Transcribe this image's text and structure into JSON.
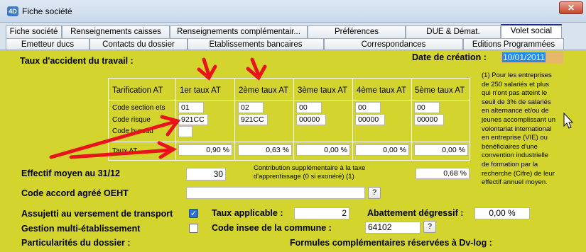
{
  "window": {
    "title": "Fiche société",
    "app_icon": "4D",
    "close_label": "✕"
  },
  "tabs_row1": [
    {
      "label": "Fiche société"
    },
    {
      "label": "Renseignements caisses"
    },
    {
      "label": "Renseignements complémentair..."
    },
    {
      "label": "Préférences"
    },
    {
      "label": "DUE & Démat."
    },
    {
      "label": "Volet social",
      "active": true
    }
  ],
  "tabs_row2": [
    {
      "label": "Emetteur ducs"
    },
    {
      "label": "Contacts du dossier"
    },
    {
      "label": "Etablissements bancaires"
    },
    {
      "label": "Correspondances"
    },
    {
      "label": "Editions Programmées"
    }
  ],
  "section": {
    "title": "Taux d'accident du travail :",
    "date_label": "Date de création :",
    "date_value": "10/01/2011"
  },
  "at_table": {
    "header_label": "Tarification AT",
    "columns": [
      "1er taux AT",
      "2ème taux AT",
      "3ème taux AT",
      "4ème taux AT",
      "5ème taux AT"
    ],
    "row_labels": [
      "Code section ets",
      "Code risque",
      "Code bureau",
      "Taux AT"
    ],
    "code_section": [
      "01",
      "02",
      "00",
      "00",
      "00"
    ],
    "code_risque": [
      "921CC",
      "921CC",
      "00000",
      "00000",
      "00000"
    ],
    "taux": [
      "0,90 %",
      "0,63 %",
      "0,00 %",
      "0,00 %",
      "0,00 %"
    ]
  },
  "note": "(1) Pour les entreprises\nde 250 salariés et plus\nqui n'ont pas atteint le\nseuil de 3% de salariés\nen alternance et/ou de\njeunes accomplissant un\nvolontariat international\nen entreprise (VIE) ou\nbénéficiaires d'une\nconvention industrielle\nde formation par la\nrecherche (Cifre) de leur\neffectif annuel moyen.",
  "effectif": {
    "label": "Effectif moyen au 31/12",
    "value": "30"
  },
  "contribution": {
    "label_line1": "Contribution supplémentaire à la taxe",
    "label_line2": "d'apprentissage (0 si exonéré) (1)",
    "value": "0,68 %"
  },
  "oeht": {
    "label": "Code accord agréé OEHT",
    "value": "",
    "help": "?"
  },
  "transport": {
    "label": "Assujetti au versement de transport",
    "checked": true,
    "check_glyph": "✓"
  },
  "taux_applicable": {
    "label": "Taux applicable :",
    "value": "2"
  },
  "abattement": {
    "label": "Abattement dégressif :",
    "value": "0,00 %"
  },
  "multi_etab": {
    "label": "Gestion multi-établissement",
    "checked": false
  },
  "insee": {
    "label": "Code insee de la commune :",
    "value": "64102",
    "help": "?"
  },
  "particularites": {
    "label": "Particularités du dossier :"
  },
  "formules": {
    "label": "Formules complémentaires réservées à Dv-log :"
  },
  "colors": {
    "panel": "#d4d42f",
    "annotation_arrow": "#e8141c",
    "accent": "#2d6fd0"
  }
}
